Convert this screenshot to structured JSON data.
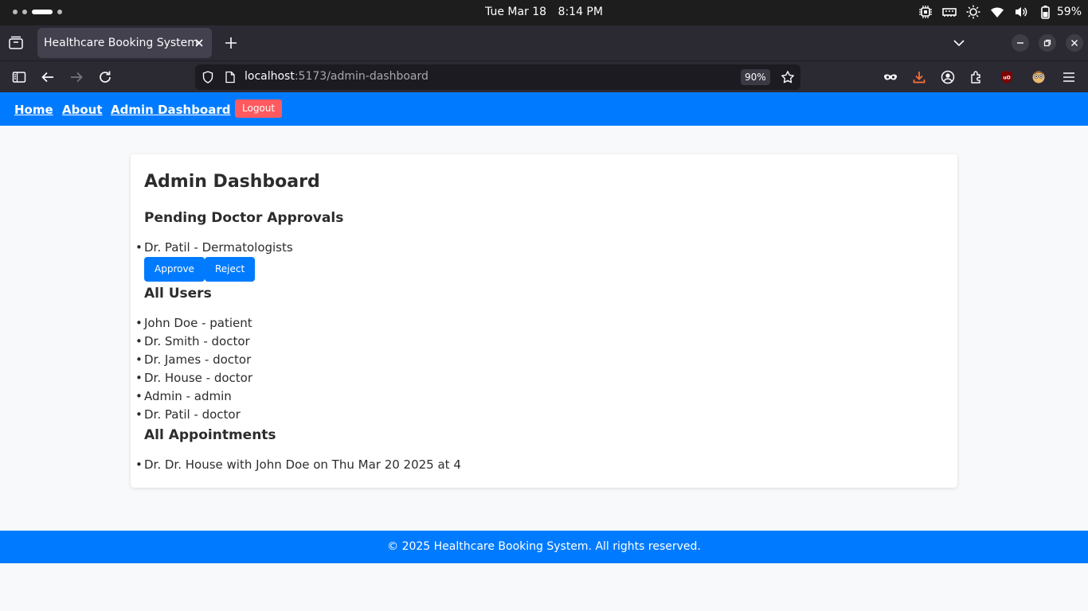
{
  "os": {
    "date": "Tue Mar 18",
    "time": "8:14 PM",
    "battery": "59%",
    "icons": [
      "cpu-icon",
      "memory-icon",
      "brightness-icon",
      "wifi-icon",
      "volume-icon",
      "battery-icon"
    ]
  },
  "browser": {
    "tab_title": "Healthcare Booking System",
    "url_host": "localhost",
    "url_rest": ":5173/admin-dashboard",
    "zoom": "90%"
  },
  "nav": {
    "home": "Home",
    "about": "About",
    "admin_dashboard": "Admin Dashboard",
    "logout": "Logout"
  },
  "page": {
    "title": "Admin Dashboard",
    "pending_heading": "Pending Doctor Approvals",
    "pending": [
      {
        "text": "Dr. Patil - Dermatologists",
        "approve": "Approve",
        "reject": "Reject"
      }
    ],
    "users_heading": "All Users",
    "users": [
      "John Doe - patient",
      "Dr. Smith - doctor",
      "Dr. James - doctor",
      "Dr. House - doctor",
      "Admin - admin",
      "Dr. Patil - doctor"
    ],
    "appointments_heading": "All Appointments",
    "appointments": [
      "Dr. Dr. House with John Doe on Thu Mar 20 2025 at 4"
    ]
  },
  "footer": {
    "text": "© 2025 Healthcare Booking System. All rights reserved."
  },
  "colors": {
    "primary": "#007bff",
    "logout": "#ff5a5f",
    "page_bg": "#f8f9fa"
  }
}
